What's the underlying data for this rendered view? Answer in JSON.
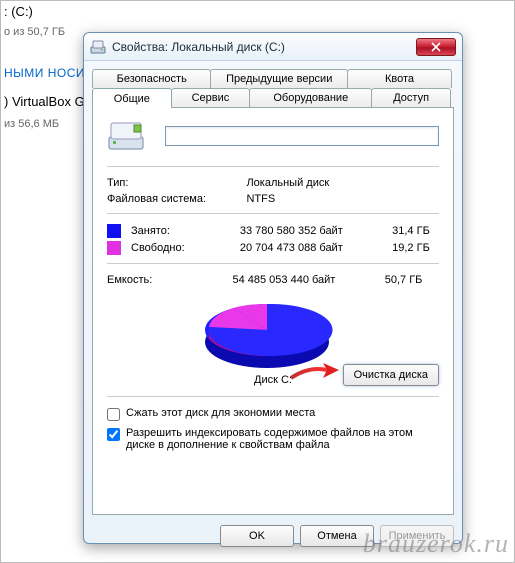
{
  "background": {
    "frag1": ": (C:)",
    "frag2": "о из 50,7 ГБ",
    "frag3": "НЫМИ НОСИТ",
    "frag4": ") VirtualBox Gu",
    "frag5": "из 56,6 МБ"
  },
  "dialog": {
    "title": "Свойства: Локальный диск (C:)",
    "tabs_top": [
      "Безопасность",
      "Предыдущие версии",
      "Квота"
    ],
    "tabs_bottom": [
      "Общие",
      "Сервис",
      "Оборудование",
      "Доступ"
    ],
    "active_tab": "Общие",
    "name_value": "",
    "type_label": "Тип:",
    "type_value": "Локальный диск",
    "fs_label": "Файловая система:",
    "fs_value": "NTFS",
    "used_label": "Занято:",
    "used_bytes": "33 780 580 352 байт",
    "used_gb": "31,4 ГБ",
    "free_label": "Свободно:",
    "free_bytes": "20 704 473 088 байт",
    "free_gb": "19,2 ГБ",
    "cap_label": "Емкость:",
    "cap_bytes": "54 485 053 440 байт",
    "cap_gb": "50,7 ГБ",
    "disk_label": "Диск C:",
    "cleanup": "Очистка диска",
    "compress": "Сжать этот диск для экономии места",
    "index": "Разрешить индексировать содержимое файлов на этом диске в дополнение к свойствам файла",
    "compress_checked": false,
    "index_checked": true,
    "ok": "OK",
    "cancel": "Отмена",
    "apply": "Применить"
  },
  "watermark": "brauzerok.ru",
  "chart_data": {
    "type": "pie",
    "title": "Диск C:",
    "series": [
      {
        "name": "Занято",
        "value": 33780580352,
        "color": "#1010f0"
      },
      {
        "name": "Свободно",
        "value": 20704473088,
        "color": "#e030e0"
      }
    ]
  }
}
